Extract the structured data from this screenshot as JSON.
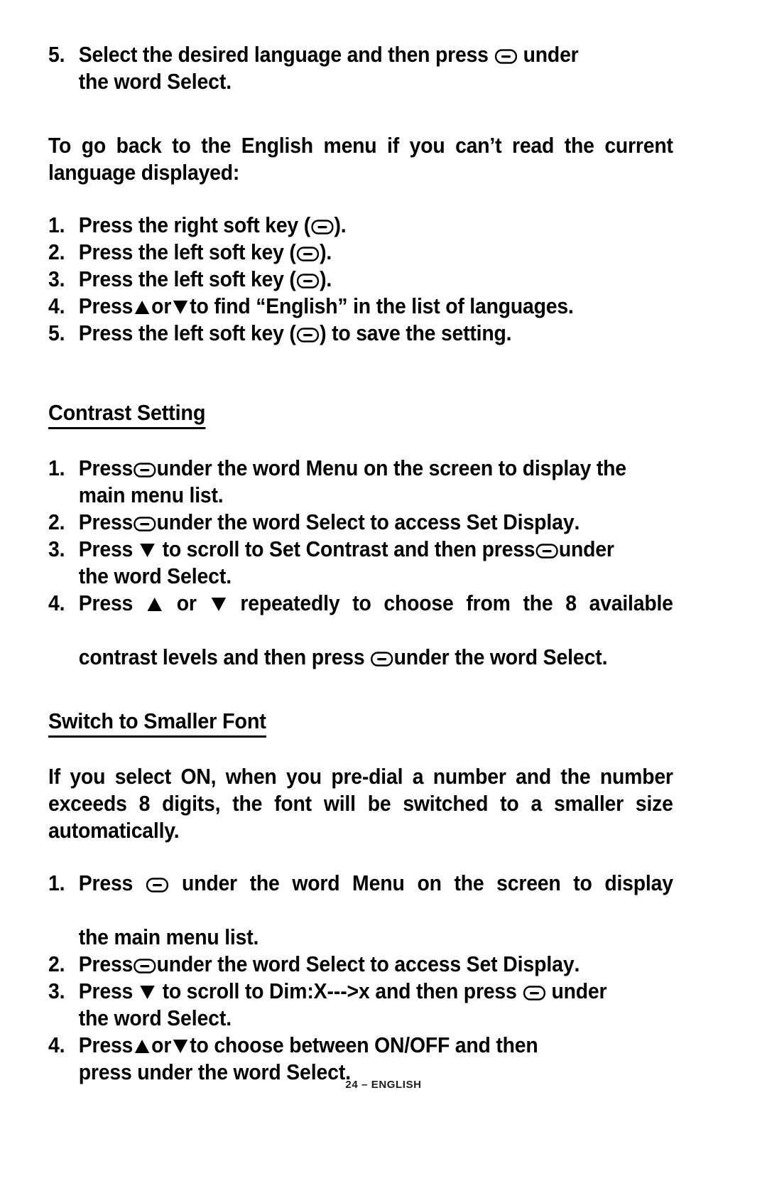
{
  "document": {
    "footer": "24 – ENGLISH",
    "page_number": "24",
    "language": "ENGLISH"
  },
  "icons": {
    "softkey": "soft-key-icon",
    "up_arrow": "up-triangle-icon",
    "down_arrow": "down-triangle-icon"
  },
  "sections": {
    "language_step5": {
      "number": "5.",
      "text_a": "Select  the  desired  language  and  then  press ",
      "text_b": " under",
      "text_c": "the word ",
      "bold_c": "Select",
      "text_d": "."
    },
    "english_menu_intro": {
      "paragraph": "To go back to the English menu if you can’t read the current language displayed:"
    },
    "english_menu_steps": [
      {
        "number": "1.",
        "pre": "Press the right soft key (",
        "post": ")."
      },
      {
        "number": "2.",
        "pre": "Press the left soft key (",
        "post": ")."
      },
      {
        "number": "3.",
        "pre": "Press the left soft key (",
        "post": ")."
      },
      {
        "number": "4.",
        "pre": "Press",
        "mid": "or",
        "post": "to find “English” in the list of languages."
      },
      {
        "number": "5.",
        "pre": "Press the left soft key (",
        "post": ") to save the setting."
      }
    ],
    "contrast": {
      "heading": "Contrast Setting",
      "steps": [
        {
          "number": "1.",
          "a": "Press",
          "b": "under the word ",
          "bold1": "Menu",
          "c": " on the screen to display the main menu list."
        },
        {
          "number": "2.",
          "a": "Press",
          "b": "under the word ",
          "bold1": "Select",
          "c": " to access ",
          "bold2": "Set Display",
          "d": "."
        },
        {
          "number": "3.",
          "a": "Press ",
          "b": " to scroll to ",
          "bold1": "Set Contrast",
          "c": " and then press",
          "d": "under",
          "e": "the word ",
          "bold2": "Select",
          "f": "."
        },
        {
          "number": "4.",
          "a": "Press ",
          "b": " or ",
          "c": " repeatedly to choose from the 8 available",
          "d": "contrast levels and then press ",
          "e": "under the word ",
          "bold1": "Select",
          "f": "."
        }
      ]
    },
    "smaller_font": {
      "heading": "Switch to Smaller Font",
      "paragraph": "If you select ON, when you pre-dial a number and the number exceeds 8 digits, the font will be switched to a smaller size automatically.",
      "steps": [
        {
          "number": "1.",
          "a": "Press ",
          "b": " under the word ",
          "bold1": "Menu",
          "c": " on the screen to display",
          "d": "the main menu list."
        },
        {
          "number": "2.",
          "a": "Press",
          "b": "under the word ",
          "bold1": "Select",
          "c": " to access ",
          "bold2": "Set Display",
          "d": "."
        },
        {
          "number": "3.",
          "a": "Press ",
          "b": " to scroll to ",
          "bold1": "Dim:X--->x",
          "c": " and then press ",
          "d": " under",
          "e": "the word ",
          "bold2": "Select",
          "f": "."
        },
        {
          "number": "4.",
          "a": "Press",
          "b": "or",
          "c": "to  choose  between  ON/OFF  and  then",
          "d": "press under the word ",
          "bold1": "Select",
          "e": "."
        }
      ]
    }
  }
}
